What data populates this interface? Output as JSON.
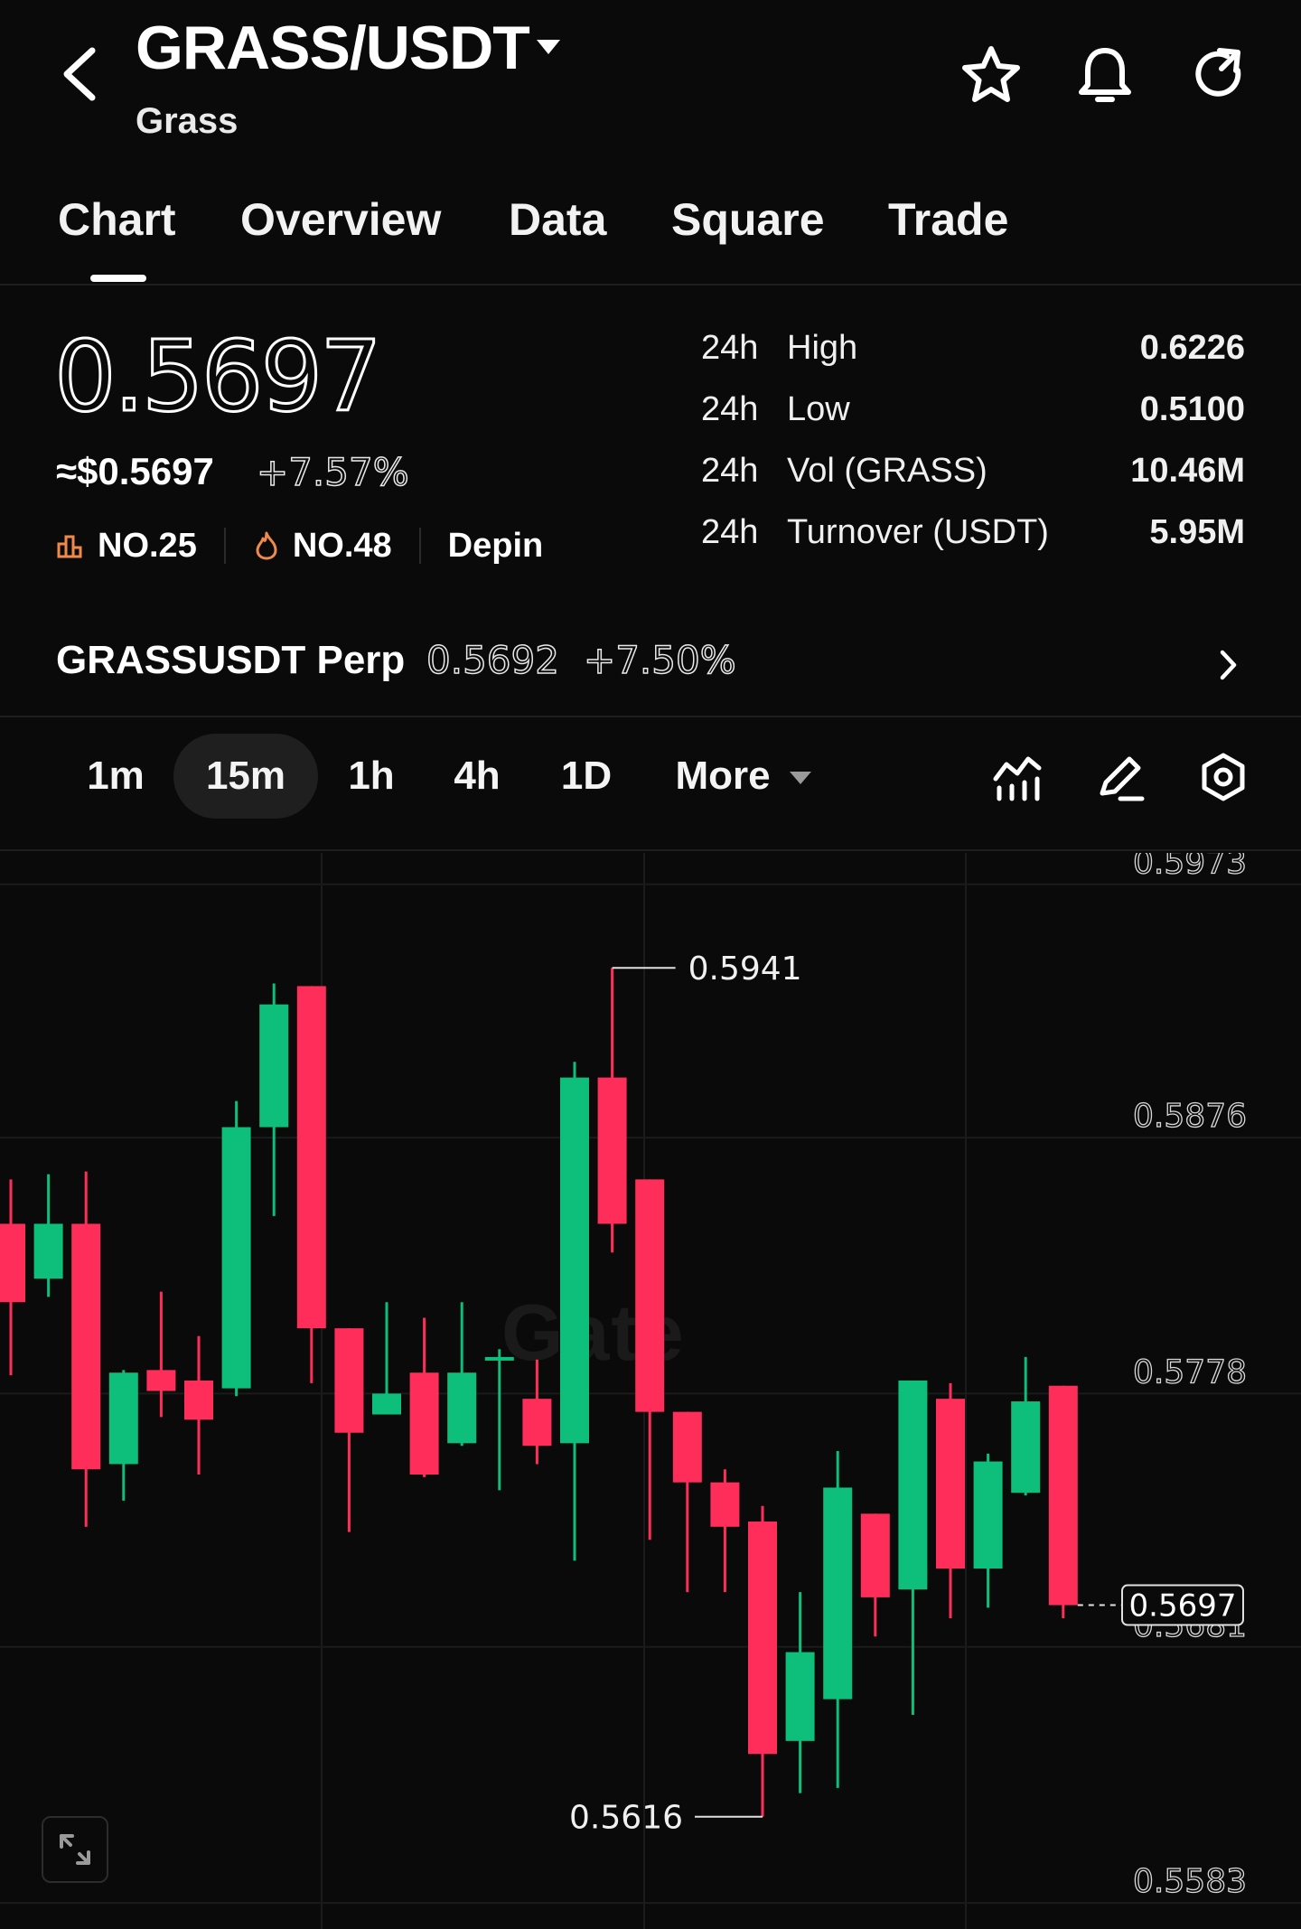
{
  "header": {
    "pair": "GRASS/USDT",
    "name": "Grass",
    "icons": [
      "star-icon",
      "bell-icon",
      "refresh-icon"
    ]
  },
  "tabs": [
    "Chart",
    "Overview",
    "Data",
    "Square",
    "Trade"
  ],
  "price": {
    "last": "0.5697",
    "usd": "≈$0.5697",
    "change": "+7.57%",
    "rank1": "NO.25",
    "rank2": "NO.48",
    "tag": "Depin"
  },
  "stats": [
    {
      "period": "24h",
      "label": "High",
      "value": "0.6226"
    },
    {
      "period": "24h",
      "label": "Low",
      "value": "0.5100"
    },
    {
      "period": "24h",
      "label": "Vol (GRASS)",
      "value": "10.46M"
    },
    {
      "period": "24h",
      "label": "Turnover (USDT)",
      "value": "5.95M"
    }
  ],
  "perp": {
    "name": "GRASSUSDT Perp",
    "price": "0.5692",
    "change": "+7.50%"
  },
  "intervals": {
    "items": [
      "1m",
      "15m",
      "1h",
      "4h",
      "1D"
    ],
    "active": "15m",
    "more": "More"
  },
  "chart": {
    "watermark": "Gate",
    "y_labels": [
      "0.5973",
      "0.5876",
      "0.5778",
      "0.5681",
      "0.5583"
    ],
    "high_label": "0.5941",
    "low_label": "0.5616",
    "current_label": "0.5697"
  },
  "colors": {
    "up": "#0dbf7a",
    "down": "#ff2d5a",
    "bg": "#0a0a0a"
  },
  "chart_data": {
    "type": "candlestick",
    "ylim": [
      0.5573,
      0.5985
    ],
    "candles": [
      {
        "o": 0.5843,
        "h": 0.586,
        "l": 0.5785,
        "c": 0.5813
      },
      {
        "o": 0.5822,
        "h": 0.5862,
        "l": 0.5815,
        "c": 0.5843
      },
      {
        "o": 0.5843,
        "h": 0.5863,
        "l": 0.5727,
        "c": 0.5749
      },
      {
        "o": 0.5751,
        "h": 0.5787,
        "l": 0.5737,
        "c": 0.5786
      },
      {
        "o": 0.5787,
        "h": 0.5817,
        "l": 0.5769,
        "c": 0.5779
      },
      {
        "o": 0.5783,
        "h": 0.58,
        "l": 0.5747,
        "c": 0.5768
      },
      {
        "o": 0.578,
        "h": 0.589,
        "l": 0.5777,
        "c": 0.588
      },
      {
        "o": 0.588,
        "h": 0.5935,
        "l": 0.5846,
        "c": 0.5927
      },
      {
        "o": 0.5934,
        "h": 0.5934,
        "l": 0.5782,
        "c": 0.5803
      },
      {
        "o": 0.5803,
        "h": 0.5803,
        "l": 0.5725,
        "c": 0.5763
      },
      {
        "o": 0.577,
        "h": 0.5813,
        "l": 0.577,
        "c": 0.5778
      },
      {
        "o": 0.5786,
        "h": 0.5807,
        "l": 0.5746,
        "c": 0.5747
      },
      {
        "o": 0.5759,
        "h": 0.5813,
        "l": 0.5758,
        "c": 0.5786
      },
      {
        "o": 0.5792,
        "h": 0.5795,
        "l": 0.5741,
        "c": 0.5792
      },
      {
        "o": 0.5776,
        "h": 0.5791,
        "l": 0.5751,
        "c": 0.5758
      },
      {
        "o": 0.5759,
        "h": 0.5905,
        "l": 0.5714,
        "c": 0.5899
      },
      {
        "o": 0.5899,
        "h": 0.5941,
        "l": 0.5832,
        "c": 0.5843
      },
      {
        "o": 0.586,
        "h": 0.586,
        "l": 0.5722,
        "c": 0.5771
      },
      {
        "o": 0.5771,
        "h": 0.5771,
        "l": 0.5702,
        "c": 0.5744
      },
      {
        "o": 0.5744,
        "h": 0.5749,
        "l": 0.5702,
        "c": 0.5727
      },
      {
        "o": 0.5729,
        "h": 0.5735,
        "l": 0.5616,
        "c": 0.564
      },
      {
        "o": 0.5645,
        "h": 0.5702,
        "l": 0.5625,
        "c": 0.5679
      },
      {
        "o": 0.5661,
        "h": 0.5756,
        "l": 0.5627,
        "c": 0.5742
      },
      {
        "o": 0.5732,
        "h": 0.5732,
        "l": 0.5685,
        "c": 0.57
      },
      {
        "o": 0.5703,
        "h": 0.5781,
        "l": 0.5655,
        "c": 0.5783
      },
      {
        "o": 0.5776,
        "h": 0.5782,
        "l": 0.5692,
        "c": 0.5711
      },
      {
        "o": 0.5711,
        "h": 0.5755,
        "l": 0.5696,
        "c": 0.5752
      },
      {
        "o": 0.574,
        "h": 0.5792,
        "l": 0.5739,
        "c": 0.5775
      },
      {
        "o": 0.5781,
        "h": 0.5781,
        "l": 0.5692,
        "c": 0.5697
      }
    ]
  }
}
